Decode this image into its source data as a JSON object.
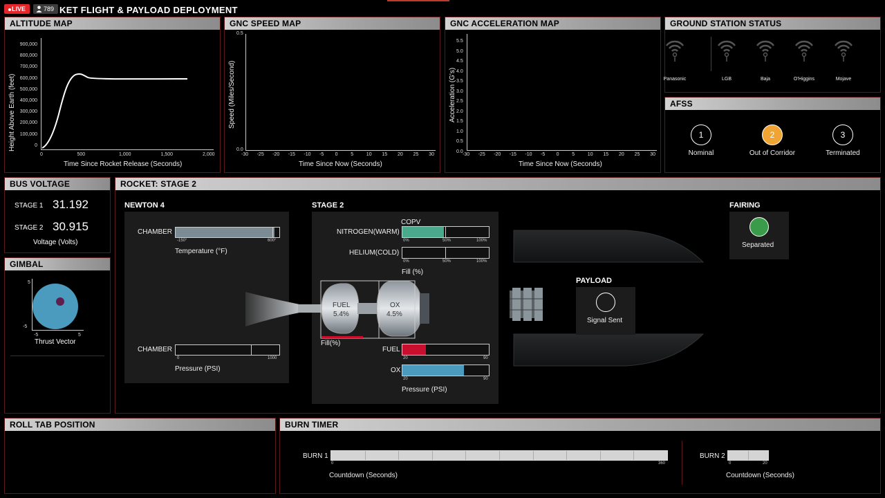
{
  "header": {
    "live_label": "LIVE",
    "viewers": "789",
    "title": "KET FLIGHT & PAYLOAD DEPLOYMENT"
  },
  "altitude": {
    "title": "ALTITUDE MAP",
    "ylabel": "Height Above Earth (feet)",
    "xlabel": "Time Since Rocket Release (Seconds)",
    "yticks": [
      "900,000",
      "800,000",
      "700,000",
      "600,000",
      "500,000",
      "400,000",
      "300,000",
      "200,000",
      "100,000",
      "0"
    ],
    "xticks": [
      "0",
      "500",
      "1,000",
      "1,500",
      "2,000"
    ]
  },
  "speed": {
    "title": "GNC SPEED MAP",
    "ylabel": "Speed (Miles/Second)",
    "xlabel": "Time Since Now (Seconds)",
    "yticks": [
      "0.5",
      "0.0"
    ],
    "xticks": [
      "-30",
      "-25",
      "-20",
      "-15",
      "-10",
      "-5",
      "0",
      "5",
      "10",
      "15",
      "20",
      "25",
      "30"
    ]
  },
  "accel": {
    "title": "GNC ACCELERATION MAP",
    "ylabel": "Acceleration (G's)",
    "xlabel": "Time Since Now (Seconds)",
    "yticks": [
      "5.5",
      "5.0",
      "4.5",
      "4.0",
      "3.5",
      "3.0",
      "2.5",
      "2.0",
      "1.5",
      "1.0",
      "0.5",
      "0.0"
    ],
    "xticks": [
      "-30",
      "-25",
      "-20",
      "-15",
      "-10",
      "-5",
      "0",
      "5",
      "10",
      "15",
      "20",
      "25",
      "30"
    ]
  },
  "ground": {
    "title": "GROUND STATION STATUS",
    "stations": [
      "Panasonic",
      "LGB",
      "Baja",
      "O'Higgins",
      "Mojave"
    ]
  },
  "afss": {
    "title": "AFSS",
    "states": [
      {
        "num": "1",
        "label": "Nominal",
        "color": "#000000"
      },
      {
        "num": "2",
        "label": "Out of Corridor",
        "color": "#f0a433"
      },
      {
        "num": "3",
        "label": "Terminated",
        "color": "#000000"
      }
    ]
  },
  "bus": {
    "title": "BUS VOLTAGE",
    "stage1_label": "STAGE 1",
    "stage1_value": "31.192",
    "stage2_label": "STAGE 2",
    "stage2_value": "30.915",
    "unit_label": "Voltage (Volts)"
  },
  "gimbal": {
    "title": "GIMBAL",
    "yticks": [
      "5",
      "-5"
    ],
    "xticks": [
      "-5",
      "5"
    ],
    "label": "Thrust Vector",
    "circle_color": "#4a9bbd",
    "dot_color": "#5e1f4f"
  },
  "rocket": {
    "title": "ROCKET: STAGE 2",
    "newton": {
      "title": "NEWTON 4",
      "temp_label": "CHAMBER",
      "temp_min": "-150°",
      "temp_max": "600°",
      "temp_fill": 0.95,
      "temp_unit": "Temperature (°F)",
      "pres_label": "CHAMBER",
      "pres_min": "0",
      "pres_max": "1000",
      "pres_unit": "Pressure (PSI)"
    },
    "stage2": {
      "title": "STAGE 2",
      "copv_label": "COPV",
      "nitrogen_label": "NITROGEN(WARM)",
      "nitrogen_fill": 0.48,
      "helium_label": "HELIUM(COLD)",
      "pct0": "0%",
      "pct50": "50%",
      "pct100": "100%",
      "fill_unit": "Fill (%)",
      "tank_fuel_label": "FUEL",
      "tank_fuel_value": "5.4%",
      "tank_ox_label": "OX",
      "tank_ox_value": "4.5%",
      "tank_fill_label": "Fill(%)",
      "fuel_label": "FUEL",
      "fuel_min": "20",
      "fuel_max": "90",
      "fuel_fill": 0.27,
      "ox_label": "OX",
      "ox_min": "20",
      "ox_max": "90",
      "ox_fill": 0.71,
      "pressure_unit": "Pressure (PSI)",
      "nitrogen_color": "#4aa98a",
      "fuel_color": "#c8102e",
      "ox_color": "#4a9bbd"
    },
    "payload": {
      "title": "PAYLOAD",
      "status": "Signal Sent"
    },
    "fairing": {
      "title": "FAIRING",
      "status": "Separated",
      "color": "#3a9b4a"
    }
  },
  "roll": {
    "title": "ROLL TAB POSITION"
  },
  "burn": {
    "title": "BURN TIMER",
    "burn1_label": "BURN 1",
    "burn1_min": "0",
    "burn1_max": "360",
    "burn1_unit": "Countdown (Seconds)",
    "burn2_label": "BURN 2",
    "burn2_min": "0",
    "burn2_max": "20",
    "burn2_unit": "Countdown (Seconds)"
  }
}
